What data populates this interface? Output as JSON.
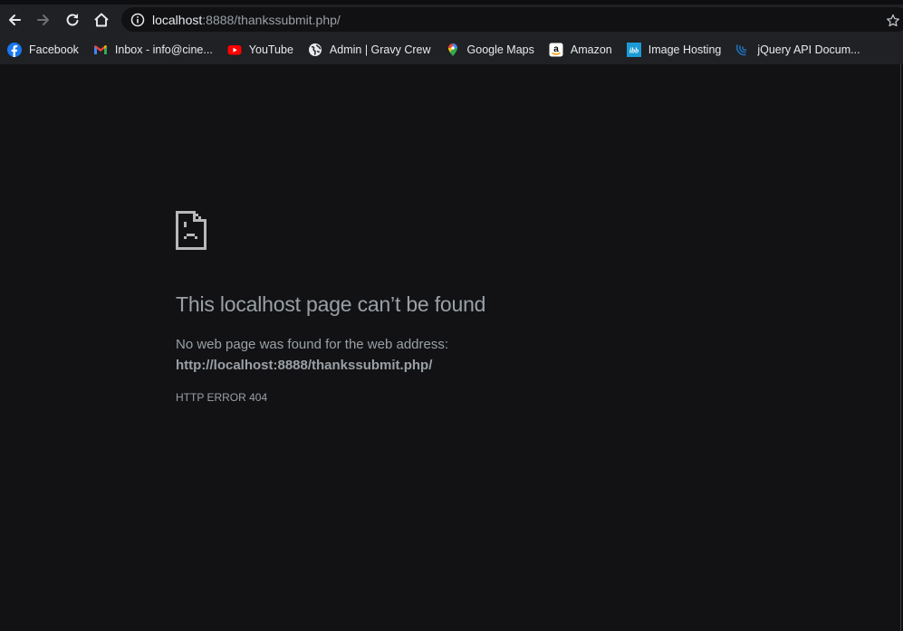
{
  "browser": {
    "nav": {
      "back_icon": "arrow-left-icon",
      "forward_icon": "arrow-right-icon",
      "reload_icon": "reload-icon",
      "home_icon": "home-icon"
    },
    "omnibox": {
      "host": "localhost",
      "rest": ":8888/thankssubmit.php/",
      "info_icon": "info-icon",
      "bookmark_icon": "star-icon"
    },
    "bookmarks": [
      {
        "label": "Facebook",
        "icon": "facebook-icon"
      },
      {
        "label": "Inbox - info@cine...",
        "icon": "gmail-icon"
      },
      {
        "label": "YouTube",
        "icon": "youtube-icon"
      },
      {
        "label": "Admin | Gravy Crew",
        "icon": "globe-icon"
      },
      {
        "label": "Google Maps",
        "icon": "maps-pin-icon"
      },
      {
        "label": "Amazon",
        "icon": "amazon-icon"
      },
      {
        "label": "Image Hosting",
        "icon": "ibb-icon"
      },
      {
        "label": "jQuery API Docum...",
        "icon": "jquery-icon"
      }
    ]
  },
  "error_page": {
    "icon": "sad-page-icon",
    "title": "This localhost page can’t be found",
    "description": "No web page was found for the web address:",
    "address": "http://localhost:8888/thankssubmit.php/",
    "error_code": "HTTP ERROR 404"
  },
  "colors": {
    "page_bg": "#121214",
    "chrome_bg": "#202124",
    "text_muted": "#9aa0a6"
  }
}
